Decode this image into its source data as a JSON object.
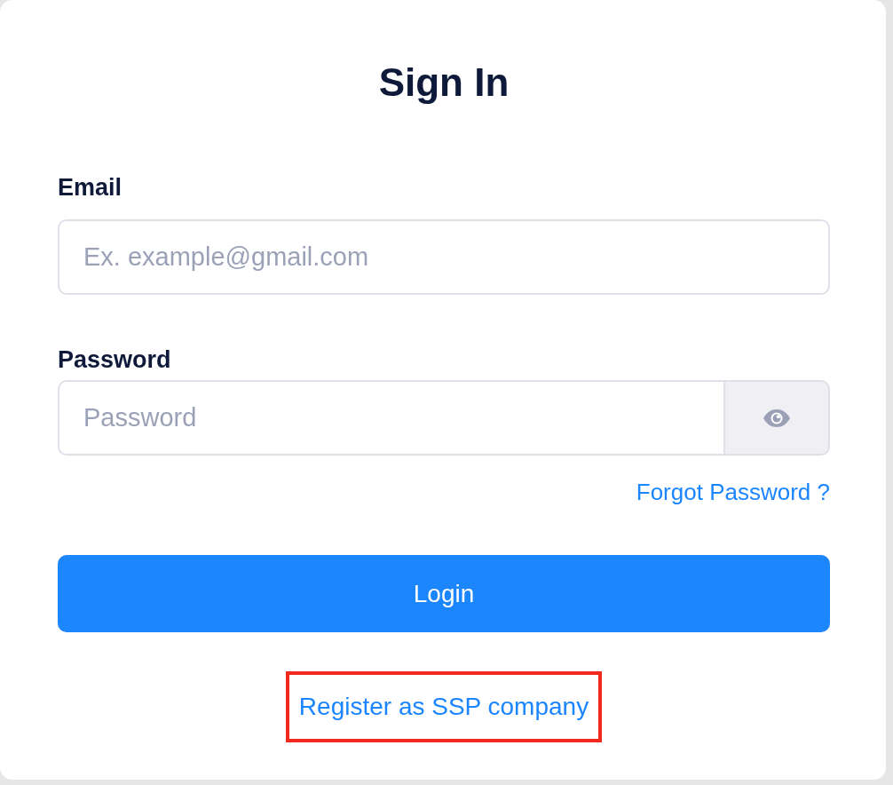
{
  "title": "Sign In",
  "fields": [
    {
      "kind": "email",
      "label": "Email",
      "placeholder": "Ex. example@gmail.com"
    },
    {
      "kind": "password",
      "label": "Password",
      "placeholder": "Password"
    }
  ],
  "forgot_link": "Forgot Password ?",
  "login_button": "Login",
  "register_link": {
    "label": "Register as SSP company",
    "highlighted": true
  }
}
